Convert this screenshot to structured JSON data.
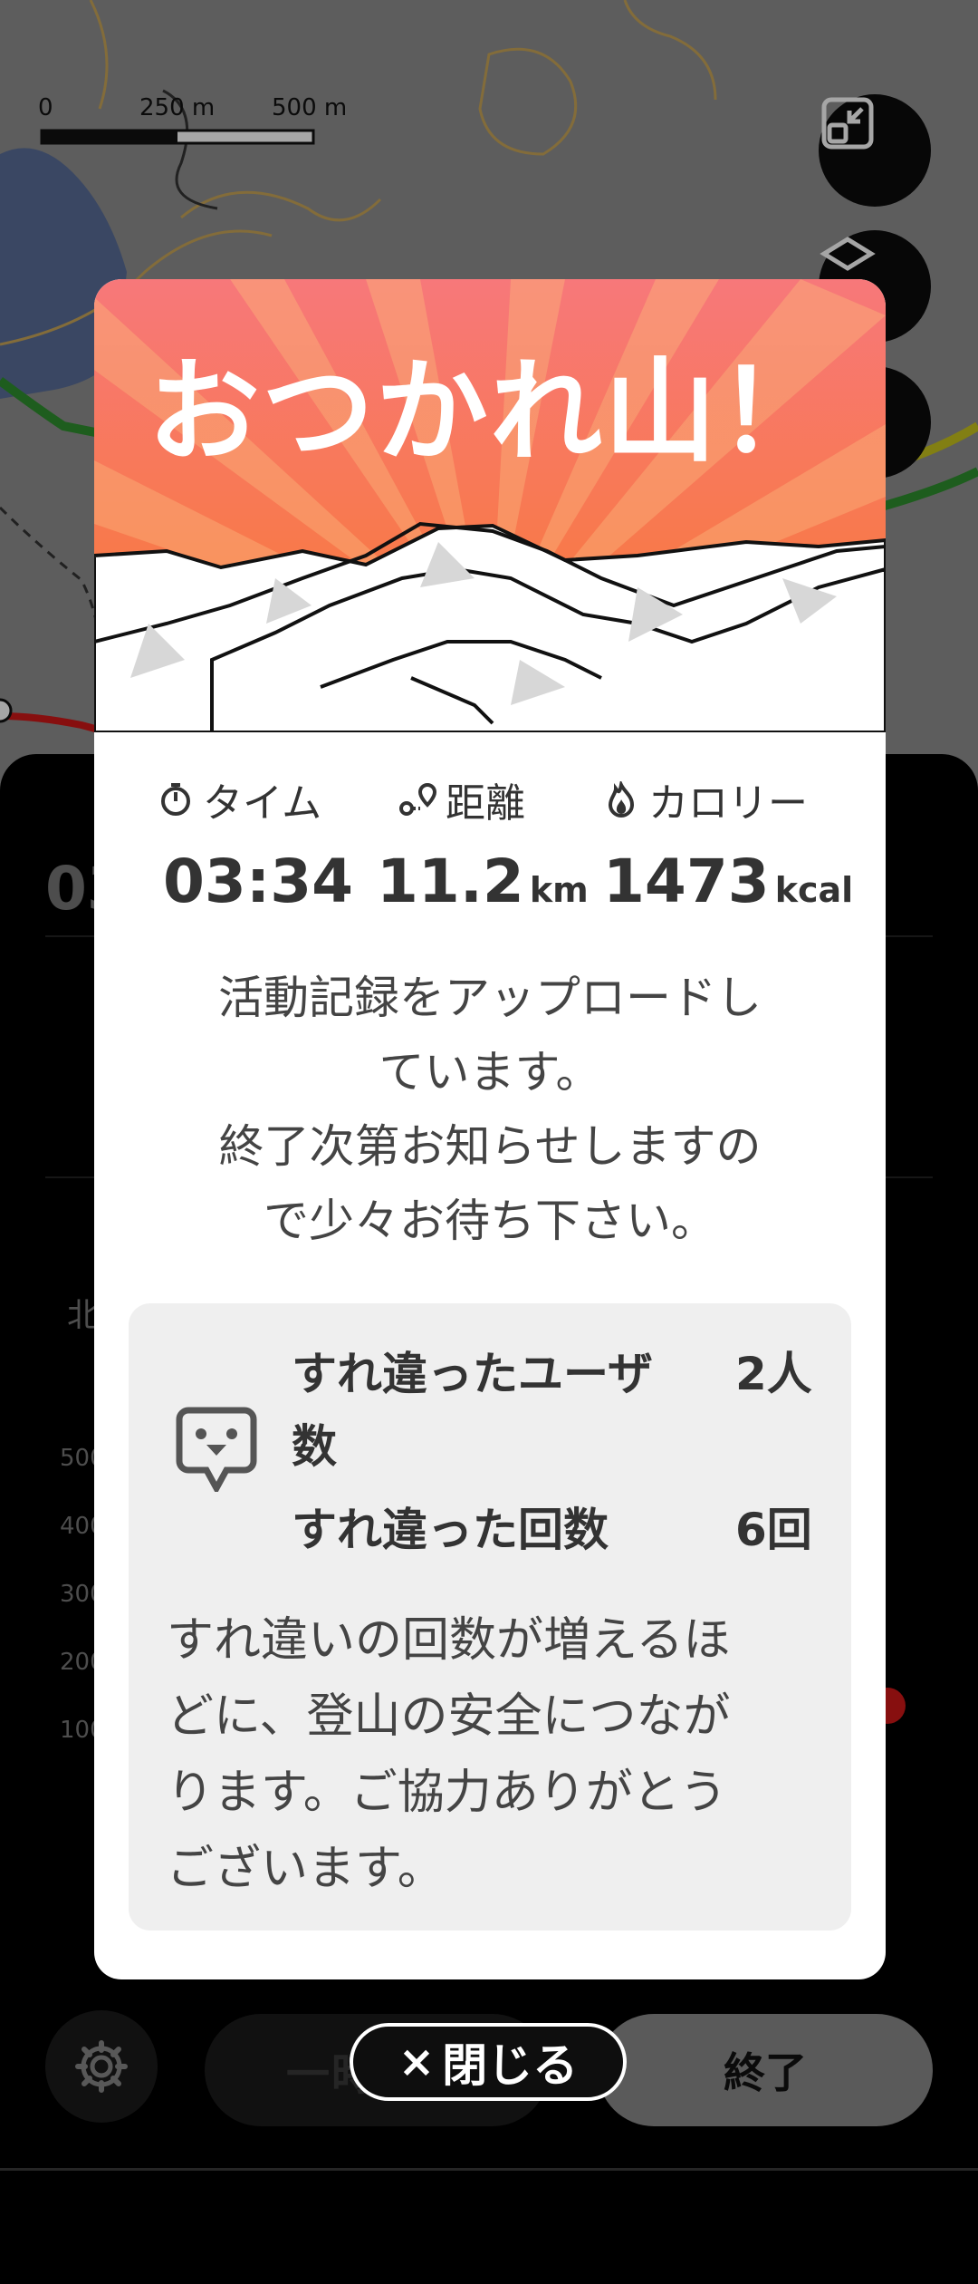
{
  "map": {
    "scale": {
      "zero": "0",
      "mid": "250 m",
      "end": "500 m"
    },
    "buttons": [
      "exit-fullscreen-icon",
      "layers-icon",
      "record-icon"
    ]
  },
  "background": {
    "time_partial": "03",
    "label_partial": "北",
    "axis_ticks": [
      "500",
      "400",
      "300",
      "200",
      "100"
    ],
    "pause_label": "一時停止",
    "end_label": "終了"
  },
  "modal": {
    "title": "おつかれ山！",
    "stats": [
      {
        "icon": "stopwatch-icon",
        "label": "タイム",
        "value": "03:34",
        "unit": ""
      },
      {
        "icon": "route-icon",
        "label": "距離",
        "value": "11.2",
        "unit": "km"
      },
      {
        "icon": "flame-icon",
        "label": "カロリー",
        "value": "1473",
        "unit": "kcal"
      }
    ],
    "message_lines": [
      "活動記録をアップロードし",
      "ています。",
      "終了次第お知らせしますの",
      "で少々お待ち下さい。"
    ],
    "passing": {
      "users_label_line1": "すれ違ったユーザ",
      "users_label_line2": "数",
      "users_value": "2人",
      "count_label": "すれ違った回数",
      "count_value": "6回",
      "text_lines": [
        "すれ違いの回数が増えるほ",
        "どに、登山の安全につなが",
        "ります。ご協力ありがとう",
        "ございます。"
      ]
    }
  },
  "close_label": "閉じる",
  "close_mark": "×",
  "colors": {
    "hero_top": "#f7787a",
    "hero_bottom": "#f97a2c",
    "info_bg": "#efefef"
  }
}
